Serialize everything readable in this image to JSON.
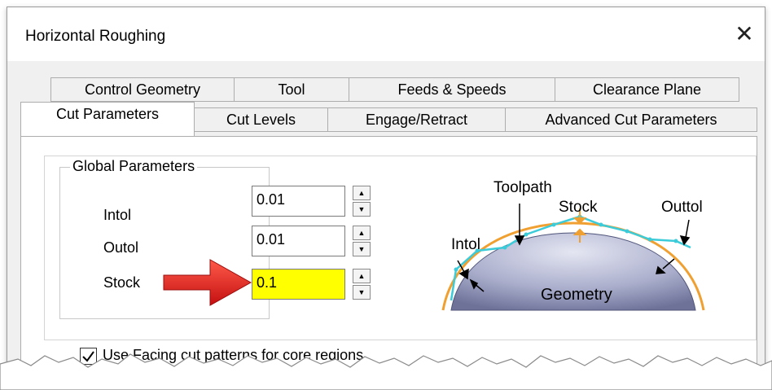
{
  "window": {
    "title": "Horizontal Roughing",
    "close_glyph": "✕"
  },
  "tabs_row1": [
    "Control Geometry",
    "Tool",
    "Feeds & Speeds",
    "Clearance Plane"
  ],
  "tabs_row2": [
    "Cut Parameters",
    "Cut Levels",
    "Engage/Retract",
    "Advanced Cut Parameters"
  ],
  "active_tab": "Cut Parameters",
  "global_params": {
    "legend": "Global Parameters",
    "intol": {
      "label": "Intol",
      "value": "0.01"
    },
    "outol": {
      "label": "Outol",
      "value": "0.01"
    },
    "stock": {
      "label": "Stock",
      "value": "0.1"
    }
  },
  "diagram": {
    "toolpath": "Toolpath",
    "stock": "Stock",
    "outtol": "Outtol",
    "intol": "Intol",
    "geometry": "Geometry"
  },
  "facing_checkbox": {
    "label": "Use Facing cut patterns for core regions",
    "checked": true
  },
  "colors": {
    "highlight": "#ffff00",
    "arrow": "#e0201a",
    "toolpath": "#3ccbd8",
    "stock_curve": "#f0a030"
  },
  "icons": {
    "close": "close-icon",
    "arrow": "red-arrow-icon",
    "spin_up": "spin-up-icon",
    "spin_down": "spin-down-icon"
  }
}
